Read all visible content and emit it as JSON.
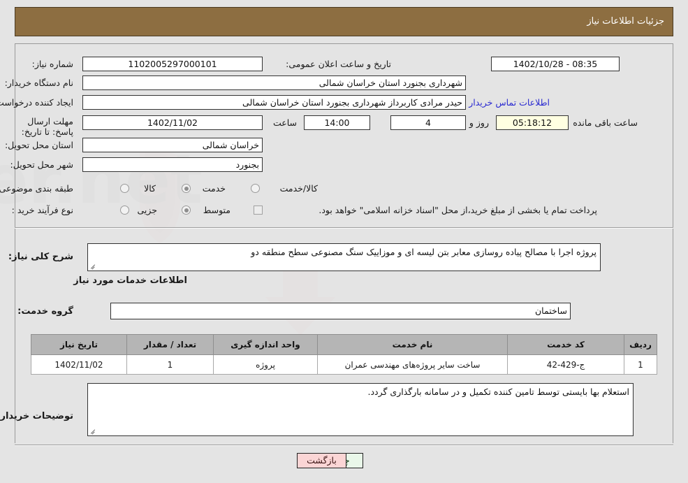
{
  "header": {
    "title": "جزئیات اطلاعات نیاز"
  },
  "watermark_text": "AnaTender.net",
  "need_info": {
    "need_number_label": "شماره نیاز:",
    "need_number_value": "1102005297000101",
    "announce_label": "تاریخ و ساعت اعلان عمومی:",
    "announce_value": "08:35 - 1402/10/28",
    "buyer_org_label": "نام دستگاه خریدار:",
    "buyer_org_value": "شهرداری بجنورد استان خراسان شمالی",
    "creator_label": "ایجاد کننده درخواست:",
    "creator_value": "حیدر مرادی کاربرداز  شهرداری بجنورد استان خراسان شمالی",
    "contact_link": "اطلاعات تماس خریدار",
    "deadline_label": "مهلت ارسال پاسخ: تا تاریخ:",
    "deadline_date": "1402/11/02",
    "deadline_time_label": "ساعت",
    "deadline_time": "14:00",
    "remaining_days": "4",
    "remaining_days_label": "روز و",
    "remaining_clock": "05:18:12",
    "remaining_clock_label": "ساعت باقی مانده",
    "province_label": "استان محل تحویل:",
    "province_value": "خراسان شمالی",
    "city_label": "شهر محل تحویل:",
    "city_value": "بجنورد",
    "category_label": "طبقه بندی موضوعی:",
    "category_options": [
      {
        "label": "کالا",
        "selected": false
      },
      {
        "label": "خدمت",
        "selected": true
      },
      {
        "label": "کالا/خدمت",
        "selected": false
      }
    ],
    "process_label": "نوع فرآیند خرید :",
    "process_options": [
      {
        "label": "جزیی",
        "selected": false
      },
      {
        "label": "متوسط",
        "selected": true
      }
    ],
    "treasury_checkbox_label": "پرداخت تمام یا بخشی از مبلغ خرید،از محل \"اسناد خزانه اسلامی\" خواهد بود.",
    "treasury_checked": false
  },
  "general_desc": {
    "label": "شرح کلی نیاز:",
    "value": "پروژه اجرا با مصالح پیاده روسازی معابر بتن لیسه ای و موزاییک سنگ مصنوعی سطح منطقه دو"
  },
  "services_section": {
    "heading": "اطلاعات خدمات مورد نیاز",
    "service_group_label": "گروه خدمت:",
    "service_group_value": "ساختمان"
  },
  "table": {
    "columns": [
      "ردیف",
      "کد خدمت",
      "نام خدمت",
      "واحد اندازه گیری",
      "تعداد / مقدار",
      "تاریخ نیاز"
    ],
    "rows": [
      {
        "row": "1",
        "code": "ج-429-42",
        "name": "ساخت سایر پروژه‌های مهندسی عمران",
        "unit": "پروژه",
        "qty": "1",
        "date": "1402/11/02"
      }
    ]
  },
  "buyer_notes": {
    "label": "توضیحات خریدار:",
    "value": "استعلام بها بایستی توسط تامین کننده تکمیل و در سامانه بارگذاری گردد."
  },
  "footer": {
    "print_label": "چاپ",
    "back_label": "بازگشت"
  },
  "colors": {
    "header_brown": "#8d6e41",
    "page_bg": "#e4e4e4",
    "link_blue": "#2a2ad0",
    "countdown_bg": "#ffffe1",
    "print_btn_bg": "#e9f7e9",
    "back_btn_bg": "#fbd5d5"
  }
}
